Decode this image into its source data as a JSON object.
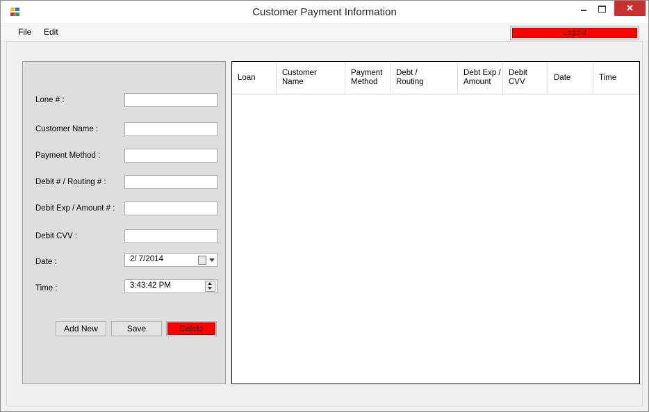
{
  "window": {
    "title": "Customer Payment Information",
    "close_glyph": "✕"
  },
  "menu": {
    "file": "File",
    "edit": "Edit"
  },
  "toolbar": {
    "logout_label": "Logout"
  },
  "form": {
    "lone_label": "Lone # :",
    "lone_value": "",
    "customer_name_label": "Customer Name :",
    "customer_name_value": "",
    "payment_method_label": "Payment Method :",
    "payment_method_value": "",
    "debit_routing_label": "Debit # / Routing # :",
    "debit_routing_value": "",
    "debit_exp_label": "Debit Exp / Amount # :",
    "debit_exp_value": "",
    "debit_cvv_label": "Debit CVV :",
    "debit_cvv_value": "",
    "date_label": "Date :",
    "date_value": "2/  7/2014",
    "time_label": "Time :",
    "time_value": "3:43:42 PM"
  },
  "buttons": {
    "add_new": "Add New",
    "save": "Save",
    "delete": "Delete"
  },
  "grid": {
    "columns": [
      "Loan",
      "Customer\nName",
      "Payment\nMethod",
      "Debt /\nRouting",
      "Debt Exp /\nAmount",
      "Debit\nCVV",
      "Date",
      "Time"
    ],
    "rows": []
  },
  "colors": {
    "danger": "#ff0000",
    "panel": "#dedede",
    "window_bg": "#f0f0f0"
  },
  "icons": [
    "app-icon",
    "minimize-icon",
    "maximize-icon",
    "close-icon",
    "calendar-icon",
    "dropdown-arrow-icon",
    "spin-up-icon",
    "spin-down-icon"
  ]
}
